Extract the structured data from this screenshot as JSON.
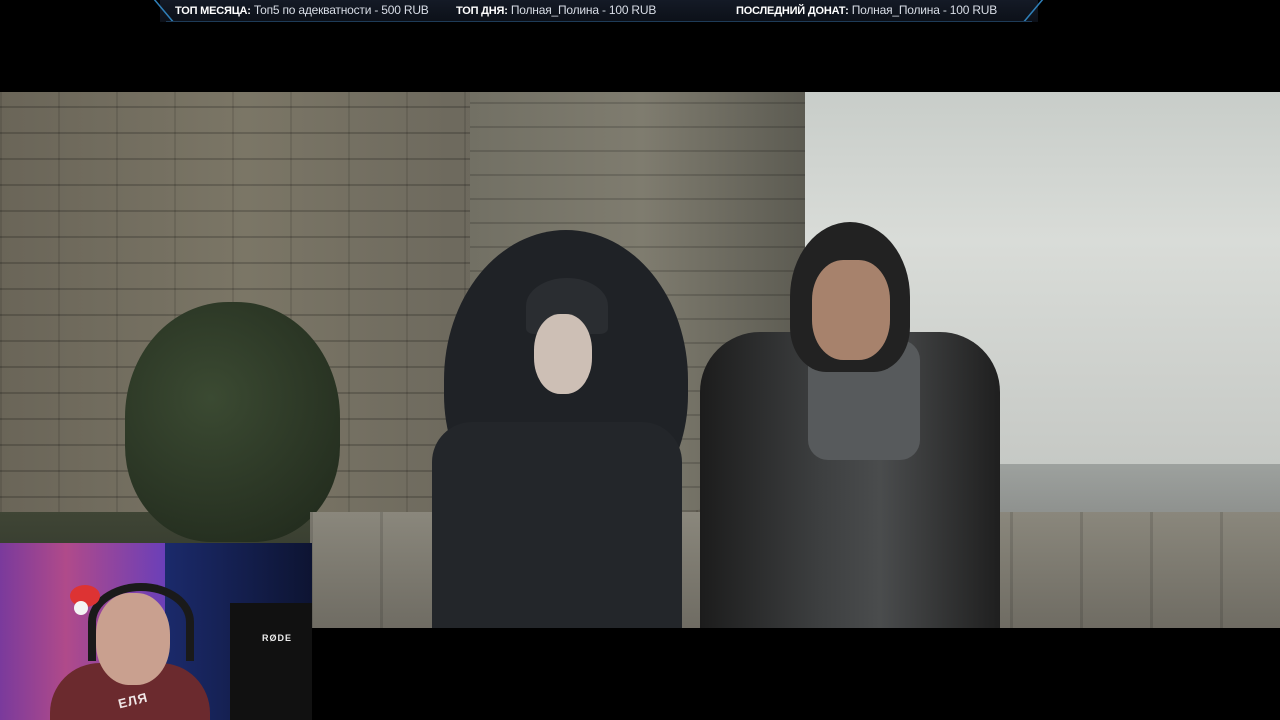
{
  "ticker": {
    "top_month_label": "ТОП МЕСЯЦА:",
    "top_month_value": "Топ5 по адекватности - 500 RUB",
    "top_day_label": "ТОП ДНЯ:",
    "top_day_value": "Полная_Полина - 100 RUB",
    "last_donate_label": "ПОСЛЕДНИЙ ДОНАТ:",
    "last_donate_value": "Полная_Полина - 100 RUB",
    "accent_color": "#2f7fb8"
  },
  "webcam": {
    "mic_brand": "RØDE",
    "shirt_text": "ЕЛЯ"
  }
}
